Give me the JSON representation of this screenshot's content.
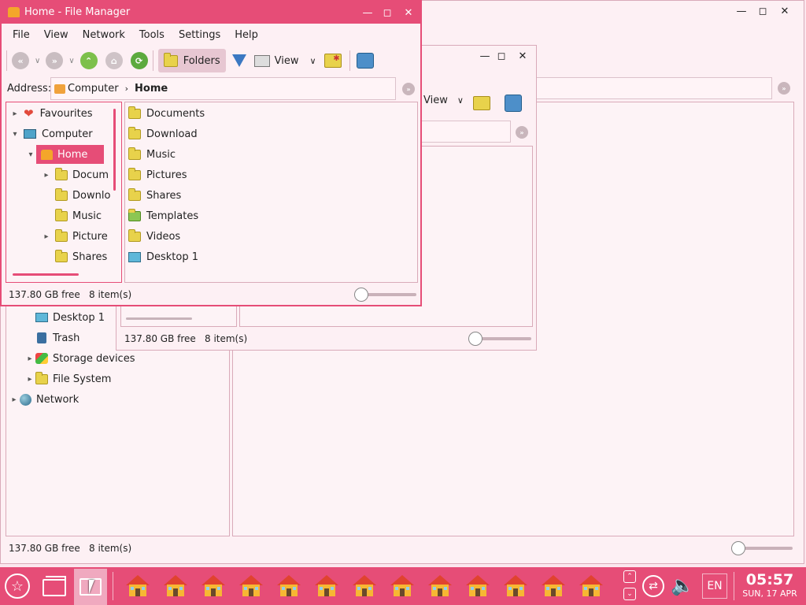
{
  "colors": {
    "accent": "#e64d77",
    "background": "#fbe7ee",
    "panel": "#fdf3f6"
  },
  "windows": {
    "main": {
      "title": "Home - File Manager",
      "menu": [
        "File",
        "View",
        "Network",
        "Tools",
        "Settings",
        "Help"
      ],
      "toolbar": {
        "folders_label": "Folders",
        "view_label": "View"
      },
      "address": {
        "label": "Address:",
        "crumb1": "Computer",
        "crumb2": "Home"
      },
      "tree": [
        {
          "label": "Favourites",
          "icon": "heart-icon"
        },
        {
          "label": "Computer",
          "icon": "computer-icon"
        },
        {
          "label": "Home",
          "icon": "home-icon"
        },
        {
          "label": "Docum",
          "icon": "folder-icon"
        },
        {
          "label": "Downlo",
          "icon": "folder-icon"
        },
        {
          "label": "Music",
          "icon": "folder-icon"
        },
        {
          "label": "Picture",
          "icon": "folder-icon"
        },
        {
          "label": "Shares",
          "icon": "folder-icon"
        }
      ],
      "files": [
        {
          "label": "Documents",
          "icon": "documents-folder-icon"
        },
        {
          "label": "Download",
          "icon": "download-folder-icon"
        },
        {
          "label": "Music",
          "icon": "music-folder-icon"
        },
        {
          "label": "Pictures",
          "icon": "pictures-folder-icon"
        },
        {
          "label": "Shares",
          "icon": "shares-folder-icon"
        },
        {
          "label": "Templates",
          "icon": "templates-folder-icon"
        },
        {
          "label": "Videos",
          "icon": "videos-folder-icon"
        },
        {
          "label": "Desktop 1",
          "icon": "desktop-icon"
        }
      ],
      "status": {
        "free": "137.80 GB free",
        "items": "8 item(s)"
      }
    },
    "middle": {
      "view_label": "View",
      "status": {
        "free": "137.80 GB free",
        "items": "8 item(s)"
      }
    },
    "back": {
      "tree": [
        {
          "label": "Desktop 1",
          "icon": "desktop-icon"
        },
        {
          "label": "Trash",
          "icon": "trash-icon"
        },
        {
          "label": "Storage devices",
          "icon": "storage-icon"
        },
        {
          "label": "File System",
          "icon": "folder-icon"
        },
        {
          "label": "Network",
          "icon": "network-icon"
        }
      ],
      "status": {
        "free": "137.80 GB free",
        "items": "8 item(s)"
      }
    }
  },
  "taskbar": {
    "language": "EN",
    "time": "05:57",
    "date": "SUN, 17 APR"
  }
}
